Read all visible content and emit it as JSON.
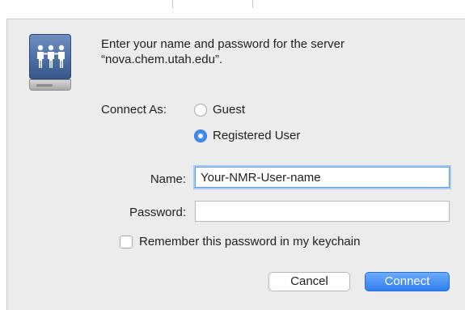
{
  "dialog": {
    "prompt_line1": "Enter your name and password for the server",
    "prompt_line2": "“nova.chem.utah.edu”.",
    "connect_as_label": "Connect As:",
    "options": [
      {
        "label": "Guest",
        "selected": false
      },
      {
        "label": "Registered User",
        "selected": true
      }
    ],
    "name_label": "Name:",
    "name_value": "Your-NMR-User-name",
    "password_label": "Password:",
    "password_value": "",
    "remember_label": "Remember this password in my keychain",
    "remember_checked": false,
    "cancel_label": "Cancel",
    "connect_label": "Connect",
    "icon": "shared-server-drive-icon",
    "accent_color": "#3d8cf0"
  }
}
